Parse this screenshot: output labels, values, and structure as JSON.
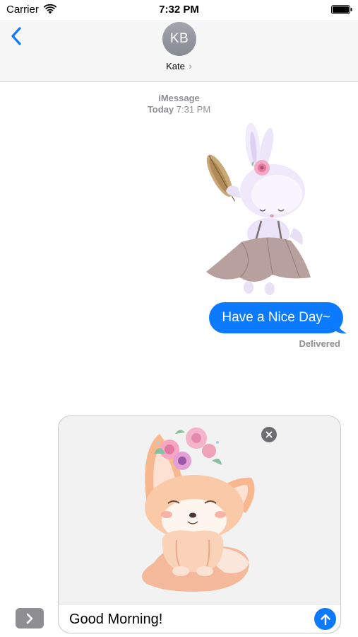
{
  "status_bar": {
    "carrier": "Carrier",
    "time": "7:32 PM",
    "icons": [
      "wifi-icon",
      "battery-icon"
    ]
  },
  "header": {
    "back_icon": "chevron-left-icon",
    "avatar_initials": "KB",
    "contact_name": "Kate",
    "contact_chevron": "›"
  },
  "thread": {
    "service": "iMessage",
    "day": "Today",
    "time": "7:31 PM",
    "messages": [
      {
        "kind": "sticker",
        "icon": "bunny-sticker"
      },
      {
        "kind": "text",
        "text": "Have a Nice Day~",
        "status": "Delivered"
      }
    ]
  },
  "composer": {
    "apps_icon": "chevron-right-icon",
    "attachment": "fox-sticker",
    "remove_icon": "close-icon",
    "input_value": "Good Morning!",
    "send_icon": "arrow-up-icon"
  },
  "colors": {
    "accent": "#0b7aff",
    "secondary_text": "#8e8e93",
    "header_bg": "#f7f7f7"
  }
}
